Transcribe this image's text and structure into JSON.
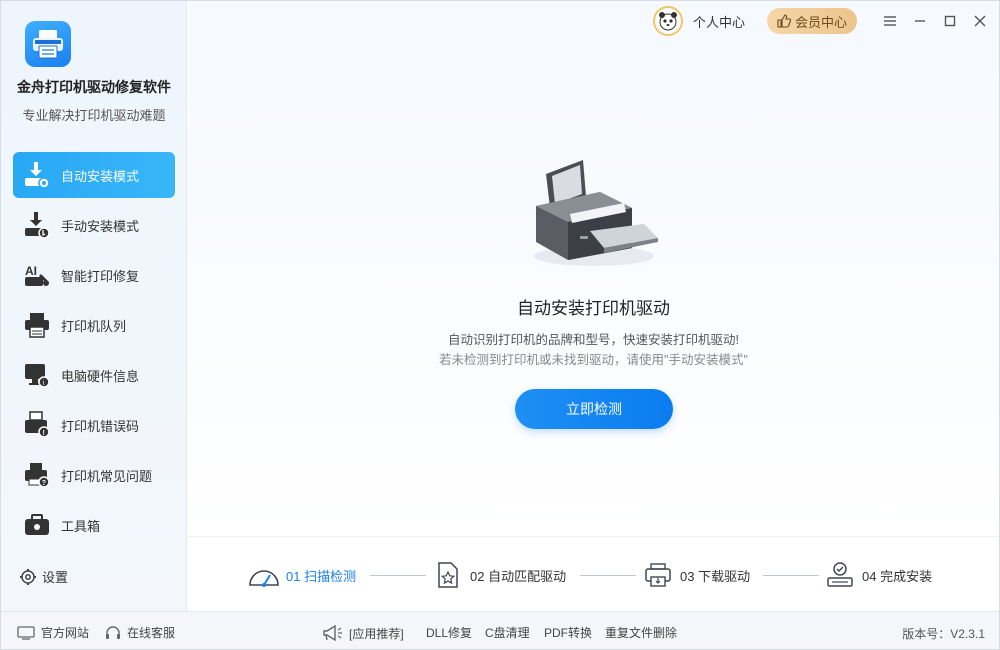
{
  "app": {
    "title": "金舟打印机驱动修复软件",
    "subtitle": "专业解决打印机驱动难题"
  },
  "sidebar": {
    "items": [
      {
        "label": "自动安装模式",
        "icon": "auto-install-icon",
        "active": true
      },
      {
        "label": "手动安装模式",
        "icon": "manual-install-icon",
        "active": false
      },
      {
        "label": "智能打印修复",
        "icon": "smart-repair-icon",
        "active": false
      },
      {
        "label": "打印机队列",
        "icon": "printer-queue-icon",
        "active": false
      },
      {
        "label": "电脑硬件信息",
        "icon": "hardware-info-icon",
        "active": false
      },
      {
        "label": "打印机错误码",
        "icon": "error-code-icon",
        "active": false
      },
      {
        "label": "打印机常见问题",
        "icon": "faq-icon",
        "active": false
      },
      {
        "label": "工具箱",
        "icon": "toolbox-icon",
        "active": false
      }
    ],
    "settings_label": "设置"
  },
  "topbar": {
    "user_label": "个人中心",
    "vip_label": "会员中心"
  },
  "main": {
    "title": "自动安装打印机驱动",
    "desc1": "自动识别打印机的品牌和型号，快速安装打印机驱动!",
    "desc2": "若未检测到打印机或未找到驱动，请使用\"手动安装模式\"",
    "detect_button": "立即检测"
  },
  "steps": [
    {
      "label": "01  扫描检测",
      "icon": "scan-icon",
      "active": true
    },
    {
      "label": "02  自动匹配驱动",
      "icon": "match-icon",
      "active": false
    },
    {
      "label": "03  下载驱动",
      "icon": "download-icon",
      "active": false
    },
    {
      "label": "04  完成安装",
      "icon": "complete-icon",
      "active": false
    }
  ],
  "footer": {
    "official_site": "官方网站",
    "online_service": "在线客服",
    "app_recommend": "[应用推荐]",
    "links": [
      "DLL修复",
      "C盘清理",
      "PDF转换",
      "重复文件删除"
    ],
    "version": "版本号：V2.3.1"
  },
  "colors": {
    "accent": "#1a7ff0",
    "sidebar_active": "#28a8f5",
    "vip_bg": "#ecc48c"
  }
}
